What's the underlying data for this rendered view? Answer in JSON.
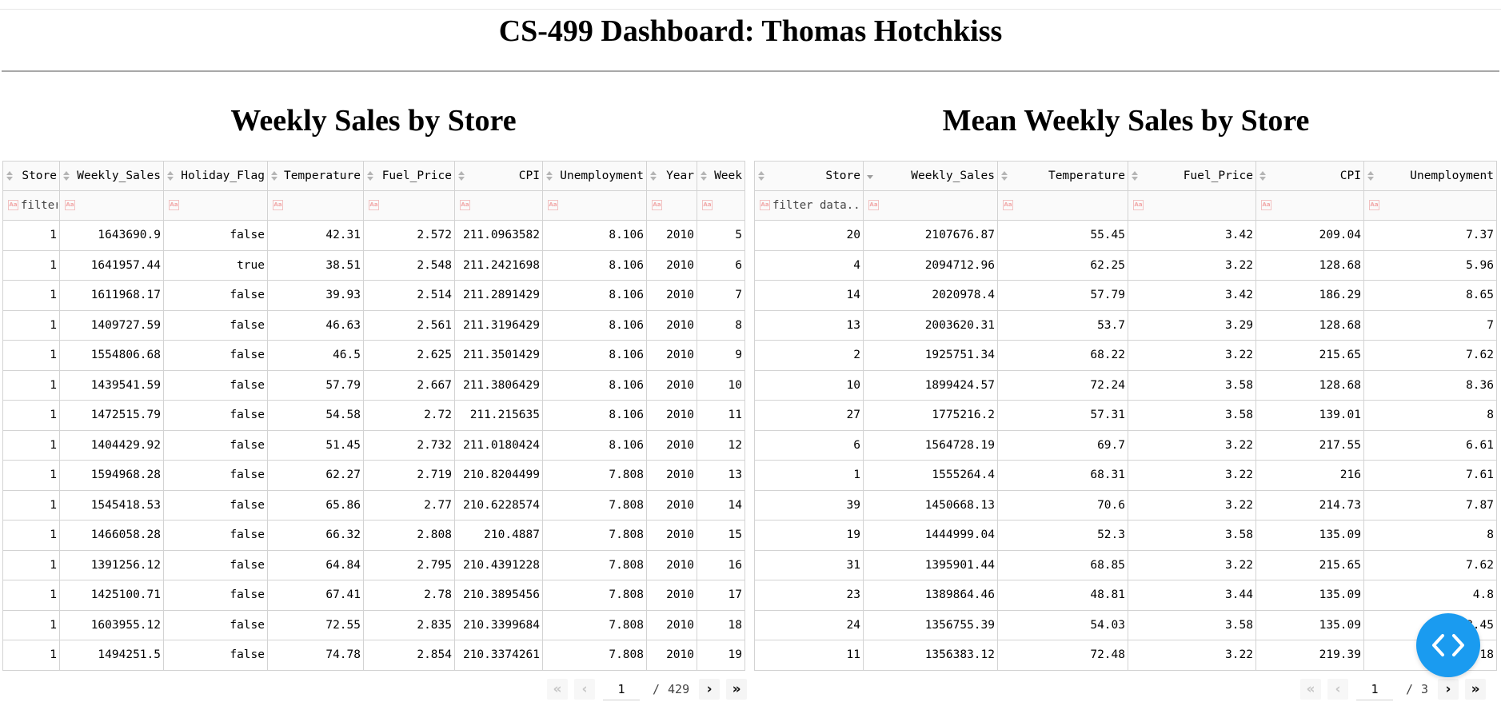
{
  "page_title": "CS-499 Dashboard: Thomas Hotchkiss",
  "left": {
    "title": "Weekly Sales by Store",
    "columns": [
      "Store",
      "Weekly_Sales",
      "Holiday_Flag",
      "Temperature",
      "Fuel_Price",
      "CPI",
      "Unemployment",
      "Year",
      "Week"
    ],
    "filter_placeholder": "filter data...",
    "rows": [
      [
        "1",
        "1643690.9",
        "false",
        "42.31",
        "2.572",
        "211.0963582",
        "8.106",
        "2010",
        "5"
      ],
      [
        "1",
        "1641957.44",
        "true",
        "38.51",
        "2.548",
        "211.2421698",
        "8.106",
        "2010",
        "6"
      ],
      [
        "1",
        "1611968.17",
        "false",
        "39.93",
        "2.514",
        "211.2891429",
        "8.106",
        "2010",
        "7"
      ],
      [
        "1",
        "1409727.59",
        "false",
        "46.63",
        "2.561",
        "211.3196429",
        "8.106",
        "2010",
        "8"
      ],
      [
        "1",
        "1554806.68",
        "false",
        "46.5",
        "2.625",
        "211.3501429",
        "8.106",
        "2010",
        "9"
      ],
      [
        "1",
        "1439541.59",
        "false",
        "57.79",
        "2.667",
        "211.3806429",
        "8.106",
        "2010",
        "10"
      ],
      [
        "1",
        "1472515.79",
        "false",
        "54.58",
        "2.72",
        "211.215635",
        "8.106",
        "2010",
        "11"
      ],
      [
        "1",
        "1404429.92",
        "false",
        "51.45",
        "2.732",
        "211.0180424",
        "8.106",
        "2010",
        "12"
      ],
      [
        "1",
        "1594968.28",
        "false",
        "62.27",
        "2.719",
        "210.8204499",
        "7.808",
        "2010",
        "13"
      ],
      [
        "1",
        "1545418.53",
        "false",
        "65.86",
        "2.77",
        "210.6228574",
        "7.808",
        "2010",
        "14"
      ],
      [
        "1",
        "1466058.28",
        "false",
        "66.32",
        "2.808",
        "210.4887",
        "7.808",
        "2010",
        "15"
      ],
      [
        "1",
        "1391256.12",
        "false",
        "64.84",
        "2.795",
        "210.4391228",
        "7.808",
        "2010",
        "16"
      ],
      [
        "1",
        "1425100.71",
        "false",
        "67.41",
        "2.78",
        "210.3895456",
        "7.808",
        "2010",
        "17"
      ],
      [
        "1",
        "1603955.12",
        "false",
        "72.55",
        "2.835",
        "210.3399684",
        "7.808",
        "2010",
        "18"
      ],
      [
        "1",
        "1494251.5",
        "false",
        "74.78",
        "2.854",
        "210.3374261",
        "7.808",
        "2010",
        "19"
      ]
    ],
    "pager": {
      "current": "1",
      "sep": "/",
      "total": "429"
    }
  },
  "right": {
    "title": "Mean Weekly Sales by Store",
    "columns": [
      "Store",
      "Weekly_Sales",
      "Temperature",
      "Fuel_Price",
      "CPI",
      "Unemployment"
    ],
    "filter_placeholder": "filter data...",
    "rows": [
      [
        "20",
        "2107676.87",
        "55.45",
        "3.42",
        "209.04",
        "7.37"
      ],
      [
        "4",
        "2094712.96",
        "62.25",
        "3.22",
        "128.68",
        "5.96"
      ],
      [
        "14",
        "2020978.4",
        "57.79",
        "3.42",
        "186.29",
        "8.65"
      ],
      [
        "13",
        "2003620.31",
        "53.7",
        "3.29",
        "128.68",
        "7"
      ],
      [
        "2",
        "1925751.34",
        "68.22",
        "3.22",
        "215.65",
        "7.62"
      ],
      [
        "10",
        "1899424.57",
        "72.24",
        "3.58",
        "128.68",
        "8.36"
      ],
      [
        "27",
        "1775216.2",
        "57.31",
        "3.58",
        "139.01",
        "8"
      ],
      [
        "6",
        "1564728.19",
        "69.7",
        "3.22",
        "217.55",
        "6.61"
      ],
      [
        "1",
        "1555264.4",
        "68.31",
        "3.22",
        "216",
        "7.61"
      ],
      [
        "39",
        "1450668.13",
        "70.6",
        "3.22",
        "214.73",
        "7.87"
      ],
      [
        "19",
        "1444999.04",
        "52.3",
        "3.58",
        "135.09",
        "8"
      ],
      [
        "31",
        "1395901.44",
        "68.85",
        "3.22",
        "215.65",
        "7.62"
      ],
      [
        "23",
        "1389864.46",
        "48.81",
        "3.44",
        "135.09",
        "4.8"
      ],
      [
        "24",
        "1356755.39",
        "54.03",
        "3.58",
        "135.09",
        "8.45"
      ],
      [
        "11",
        "1356383.12",
        "72.48",
        "3.22",
        "219.39",
        "7.18"
      ]
    ],
    "pager": {
      "current": "1",
      "sep": "/",
      "total": "3"
    }
  },
  "icons": {
    "first": "«",
    "prev": "‹",
    "next": "›",
    "last": "»",
    "sort": "sort-both-icon",
    "sort_desc": "sort-desc-icon",
    "case": "case-sensitive-icon",
    "fab": "code-brackets-icon"
  },
  "colors": {
    "fab": "#1a9bf0",
    "border": "#d3d3d3",
    "header_bg": "#fafafa"
  }
}
